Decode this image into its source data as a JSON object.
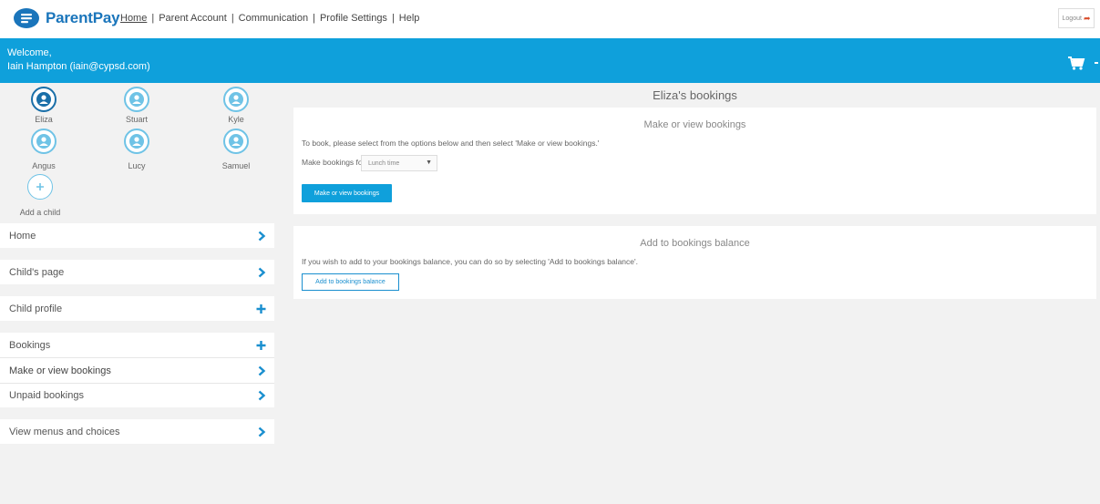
{
  "app": {
    "name": "ParentPay"
  },
  "topnav": {
    "items": [
      "Home",
      "Parent Account",
      "Communication",
      "Profile Settings",
      "Help"
    ],
    "logout": "Logout"
  },
  "banner": {
    "welcome": "Welcome,",
    "user": "Iain Hampton (iain@cypsd.com)"
  },
  "children": [
    {
      "name": "Eliza",
      "selected": true
    },
    {
      "name": "Stuart",
      "selected": false
    },
    {
      "name": "Kyle",
      "selected": false
    },
    {
      "name": "Angus",
      "selected": false
    },
    {
      "name": "Lucy",
      "selected": false
    },
    {
      "name": "Samuel",
      "selected": false
    }
  ],
  "add_child": "Add a child",
  "sidebar": {
    "home": "Home",
    "childs_page": "Child's page",
    "child_profile": "Child profile",
    "bookings": "Bookings",
    "make_or_view": "Make or view bookings",
    "unpaid": "Unpaid bookings",
    "view_menus": "View menus and choices"
  },
  "main": {
    "title": "Eliza's bookings",
    "card1": {
      "title": "Make or view bookings",
      "text": "To book, please select from the options below and then select 'Make or view bookings.'",
      "label": "Make bookings for:",
      "select_value": "Lunch time",
      "button": "Make or view bookings"
    },
    "card2": {
      "title": "Add to bookings balance",
      "text": "If you wish to add to your bookings balance, you can do so by selecting 'Add to bookings balance'.",
      "button": "Add to bookings balance"
    }
  },
  "colors": {
    "brand_blue": "#1a75bb",
    "banner_blue": "#0fa0db",
    "accent": "#1a8fcf"
  }
}
